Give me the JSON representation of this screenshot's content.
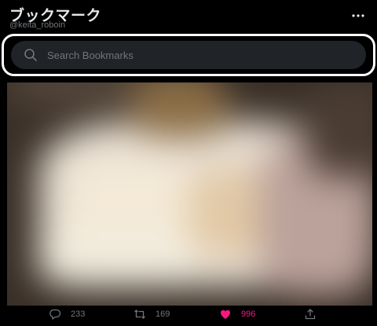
{
  "header": {
    "title": "ブックマーク",
    "handle": "@keita_roboin",
    "more_icon": "more-horizontal-icon"
  },
  "search": {
    "placeholder": "Search Bookmarks",
    "value": "",
    "icon": "search-icon"
  },
  "tweet": {
    "media_description_icon": "blurred-image",
    "actions": {
      "reply_count": "233",
      "retweet_count": "169",
      "like_count": "996",
      "liked": true,
      "share_icon": "share-icon"
    }
  },
  "colors": {
    "background": "#000000",
    "search_bg": "#202327",
    "muted": "#71767b",
    "like": "#f91880",
    "text": "#e7e9ea"
  }
}
